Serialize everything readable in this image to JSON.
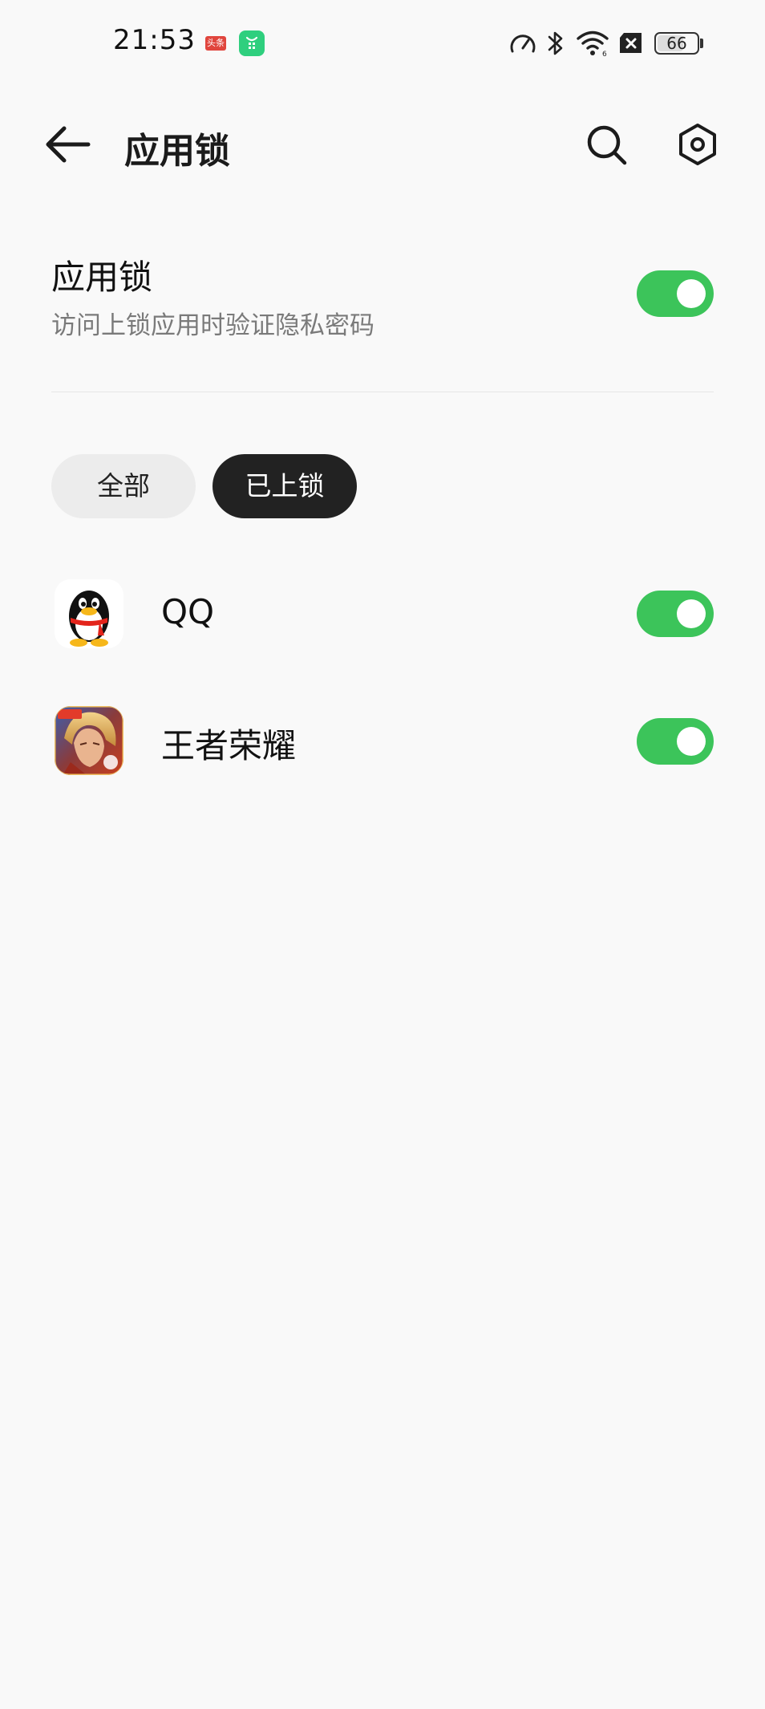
{
  "status_bar": {
    "time": "21:53",
    "toutiao_label": "头条",
    "battery_level": "66"
  },
  "app_bar": {
    "title": "应用锁"
  },
  "master": {
    "title": "应用锁",
    "subtitle": "访问上锁应用时验证隐私密码",
    "enabled": true
  },
  "filters": {
    "all_label": "全部",
    "locked_label": "已上锁",
    "selected": "已上锁"
  },
  "apps": [
    {
      "name": "QQ",
      "icon": "qq-penguin-icon",
      "locked": true
    },
    {
      "name": "王者荣耀",
      "icon": "honor-of-kings-icon",
      "locked": true
    }
  ],
  "colors": {
    "accent": "#3cc45a",
    "background": "#f9f9f9",
    "chip_selected": "#222222",
    "chip_unselected": "#ececec"
  }
}
